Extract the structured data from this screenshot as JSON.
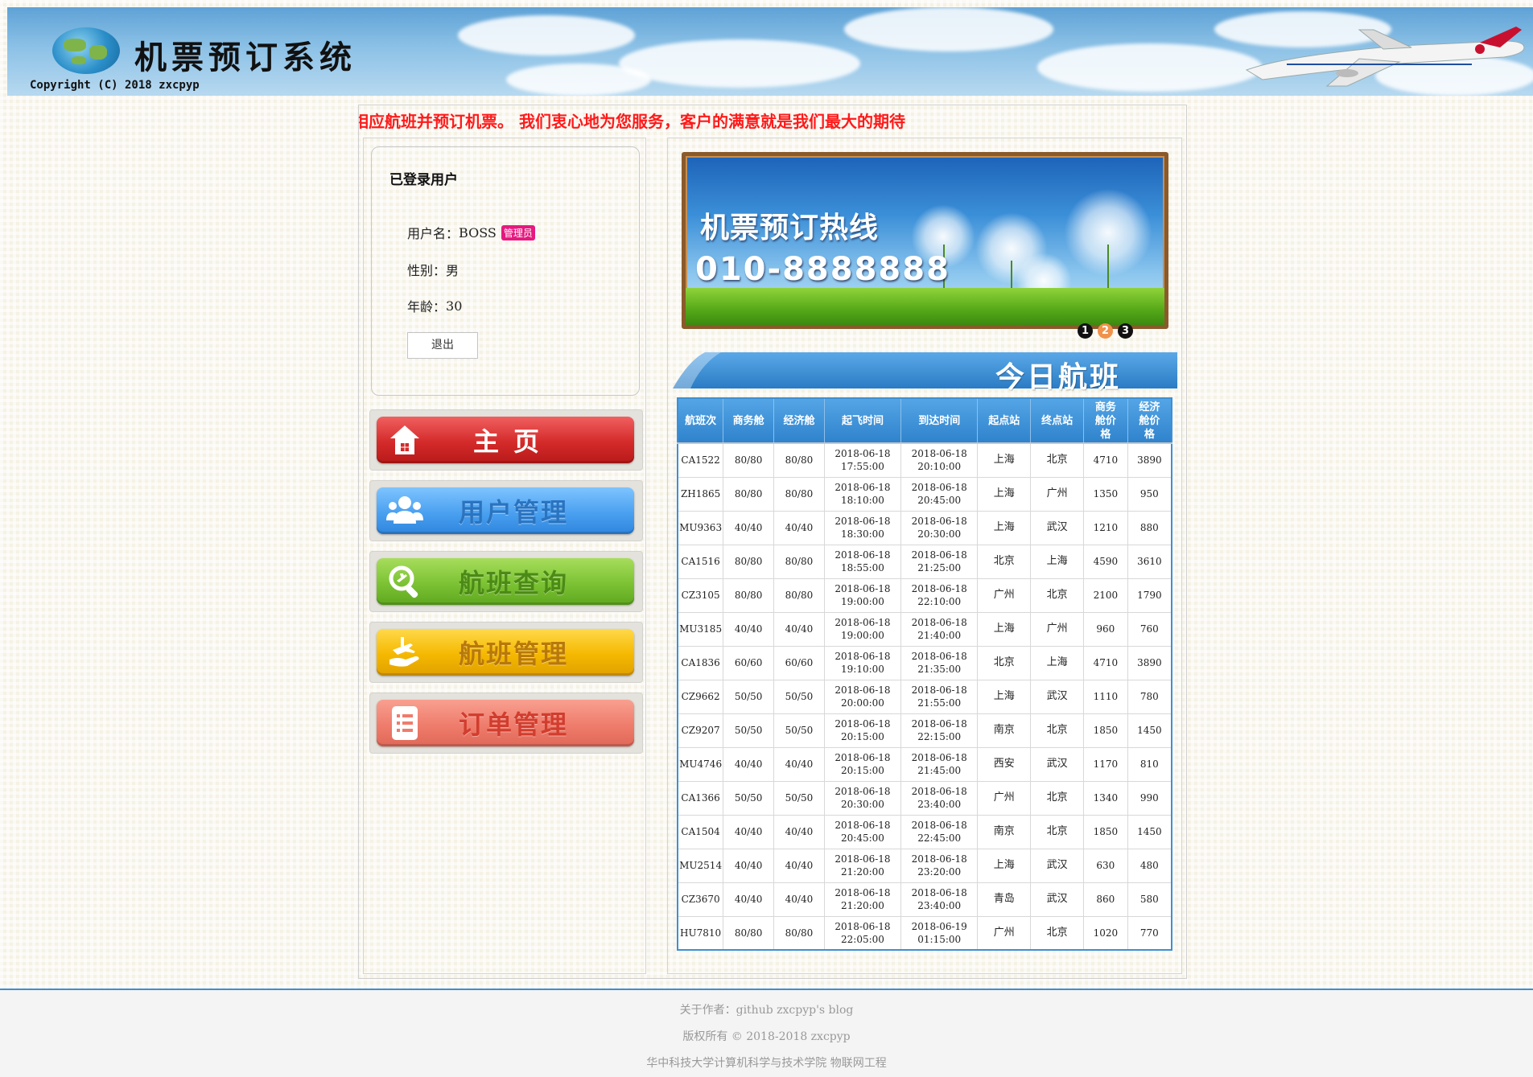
{
  "header": {
    "title": "机票预订系统",
    "copyright": "Copyright (C) 2018 zxcpyp"
  },
  "marquee": {
    "text": "相应航班并预订机票。     我们衷心地为您服务，客户的满意就是我们最大的期待"
  },
  "user_card": {
    "title": "已登录用户",
    "username_label": "用户名：",
    "username": "BOSS",
    "role_badge": "管理员",
    "gender_label": "性别：",
    "gender": "男",
    "age_label": "年龄：",
    "age": "30",
    "logout_label": "退出"
  },
  "nav": {
    "items": [
      {
        "label": "主页",
        "icon": "home-icon",
        "color": "#d42a2a"
      },
      {
        "label": "用户管理",
        "icon": "users-icon",
        "color": "#4aa0f0"
      },
      {
        "label": "航班查询",
        "icon": "search-plane-icon",
        "color": "#7cc234"
      },
      {
        "label": "航班管理",
        "icon": "plane-hand-icon",
        "color": "#f5b800"
      },
      {
        "label": "订单管理",
        "icon": "list-icon",
        "color": "#ef7c6c"
      }
    ]
  },
  "hotline": {
    "title": "机票预订热线",
    "phone": "010-8888888",
    "dots": [
      "1",
      "2",
      "3"
    ],
    "active_dot": "2"
  },
  "today": {
    "title": "今日航班"
  },
  "table": {
    "headers": [
      "航班次",
      "商务舱",
      "经济舱",
      "起飞时间",
      "到达时间",
      "起点站",
      "终点站",
      "商务舱价格",
      "经济舱价格"
    ],
    "rows": [
      [
        "CA1522",
        "80/80",
        "80/80",
        "2018-06-18",
        "17:55:00",
        "2018-06-18",
        "20:10:00",
        "上海",
        "北京",
        "4710",
        "3890"
      ],
      [
        "ZH1865",
        "80/80",
        "80/80",
        "2018-06-18",
        "18:10:00",
        "2018-06-18",
        "20:45:00",
        "上海",
        "广州",
        "1350",
        "950"
      ],
      [
        "MU9363",
        "40/40",
        "40/40",
        "2018-06-18",
        "18:30:00",
        "2018-06-18",
        "20:30:00",
        "上海",
        "武汉",
        "1210",
        "880"
      ],
      [
        "CA1516",
        "80/80",
        "80/80",
        "2018-06-18",
        "18:55:00",
        "2018-06-18",
        "21:25:00",
        "北京",
        "上海",
        "4590",
        "3610"
      ],
      [
        "CZ3105",
        "80/80",
        "80/80",
        "2018-06-18",
        "19:00:00",
        "2018-06-18",
        "22:10:00",
        "广州",
        "北京",
        "2100",
        "1790"
      ],
      [
        "MU3185",
        "40/40",
        "40/40",
        "2018-06-18",
        "19:00:00",
        "2018-06-18",
        "21:40:00",
        "上海",
        "广州",
        "960",
        "760"
      ],
      [
        "CA1836",
        "60/60",
        "60/60",
        "2018-06-18",
        "19:10:00",
        "2018-06-18",
        "21:35:00",
        "北京",
        "上海",
        "4710",
        "3890"
      ],
      [
        "CZ9662",
        "50/50",
        "50/50",
        "2018-06-18",
        "20:00:00",
        "2018-06-18",
        "21:55:00",
        "上海",
        "武汉",
        "1110",
        "780"
      ],
      [
        "CZ9207",
        "50/50",
        "50/50",
        "2018-06-18",
        "20:15:00",
        "2018-06-18",
        "22:15:00",
        "南京",
        "北京",
        "1850",
        "1450"
      ],
      [
        "MU4746",
        "40/40",
        "40/40",
        "2018-06-18",
        "20:15:00",
        "2018-06-18",
        "21:45:00",
        "西安",
        "武汉",
        "1170",
        "810"
      ],
      [
        "CA1366",
        "50/50",
        "50/50",
        "2018-06-18",
        "20:30:00",
        "2018-06-18",
        "23:40:00",
        "广州",
        "北京",
        "1340",
        "990"
      ],
      [
        "CA1504",
        "40/40",
        "40/40",
        "2018-06-18",
        "20:45:00",
        "2018-06-18",
        "22:45:00",
        "南京",
        "北京",
        "1850",
        "1450"
      ],
      [
        "MU2514",
        "40/40",
        "40/40",
        "2018-06-18",
        "21:20:00",
        "2018-06-18",
        "23:20:00",
        "上海",
        "武汉",
        "630",
        "480"
      ],
      [
        "CZ3670",
        "40/40",
        "40/40",
        "2018-06-18",
        "21:20:00",
        "2018-06-18",
        "23:40:00",
        "青岛",
        "武汉",
        "860",
        "580"
      ],
      [
        "HU7810",
        "80/80",
        "80/80",
        "2018-06-18",
        "22:05:00",
        "2018-06-19",
        "01:15:00",
        "广州",
        "北京",
        "1020",
        "770"
      ]
    ]
  },
  "footer": {
    "about": "关于作者：github zxcpyp's blog",
    "rights": "版权所有 © 2018-2018 zxcpyp",
    "school": "华中科技大学计算机科学与技术学院 物联网工程"
  }
}
